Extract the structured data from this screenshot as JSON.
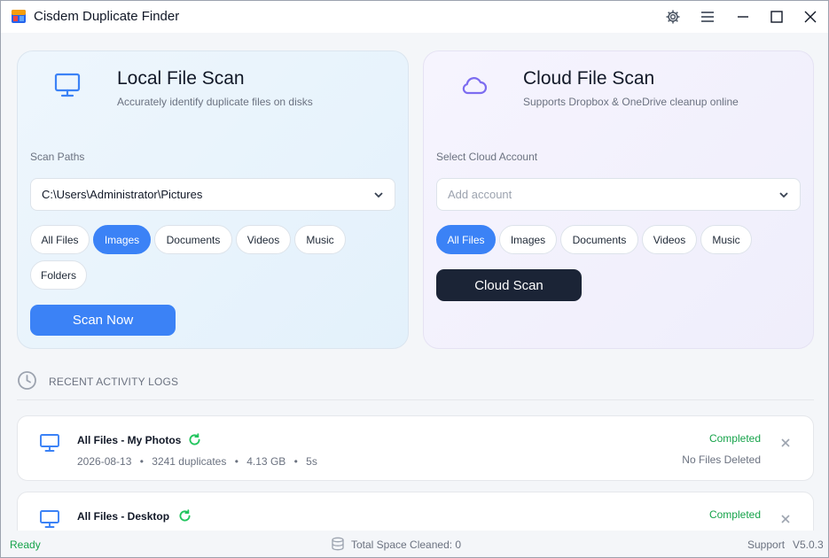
{
  "app": {
    "title": "Cisdem Duplicate Finder",
    "icons": [
      "settings-gear-icon",
      "menu-icon",
      "minimize-icon",
      "maximize-icon",
      "close-icon"
    ]
  },
  "local_scan": {
    "title": "Local File Scan",
    "subtitle": "Accurately identify duplicate files on disks",
    "paths_label": "Scan Paths",
    "path_value": "C:\\Users\\Administrator\\Pictures",
    "filters": [
      "All Files",
      "Images",
      "Documents",
      "Videos",
      "Music",
      "Folders"
    ],
    "active_filter": "Images",
    "scan_button": "Scan Now",
    "icon": "monitor-icon"
  },
  "cloud_scan": {
    "title": "Cloud File Scan",
    "subtitle": "Supports Dropbox & OneDrive cleanup online",
    "account_label": "Select Cloud Account",
    "account_placeholder": "Add account",
    "filters": [
      "All Files",
      "Images",
      "Documents",
      "Videos",
      "Music"
    ],
    "active_filter": "All Files",
    "scan_button": "Cloud Scan",
    "icon": "cloud-icon"
  },
  "recent": {
    "title": "RECENT ACTIVITY LOGS",
    "logs": [
      {
        "title": "All Files - My Photos",
        "date": "2026-08-13",
        "duplicates": "3241 duplicates",
        "size": "4.13 GB",
        "duration": "5s",
        "status": "Completed",
        "deleted": "No Files Deleted"
      },
      {
        "title": "All Files - Desktop",
        "status": "Completed"
      }
    ]
  },
  "statusbar": {
    "ready": "Ready",
    "space": "Total Space Cleaned: 0",
    "support": "Support",
    "version": "V5.0.3"
  },
  "colors": {
    "accent": "#3b82f6",
    "dark_button": "#1b2436",
    "success": "#16a34a",
    "cloud_icon": "#7c6cf0"
  }
}
